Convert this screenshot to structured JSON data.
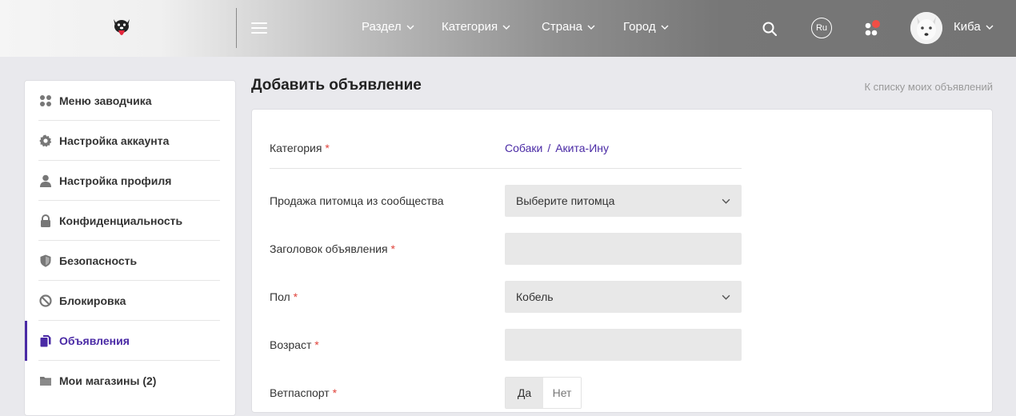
{
  "header": {
    "nav": [
      {
        "label": "Раздел"
      },
      {
        "label": "Категория"
      },
      {
        "label": "Страна"
      },
      {
        "label": "Город"
      }
    ],
    "lang": "Ru",
    "user_name": "Киба",
    "notification_color": "#f04e45"
  },
  "sidebar": {
    "items": [
      {
        "label": "Меню заводчика",
        "icon": "grid-icon"
      },
      {
        "label": "Настройка аккаунта",
        "icon": "gear-icon"
      },
      {
        "label": "Настройка профиля",
        "icon": "user-icon"
      },
      {
        "label": "Конфиденциальность",
        "icon": "lock-icon"
      },
      {
        "label": "Безопасность",
        "icon": "shield-icon"
      },
      {
        "label": "Блокировка",
        "icon": "block-icon"
      },
      {
        "label": "Объявления",
        "icon": "documents-icon",
        "active": true
      },
      {
        "label": "Мои магазины (2)",
        "icon": "folder-icon"
      }
    ],
    "accent": "#4a2aa5"
  },
  "main": {
    "title": "Добавить объявление",
    "back_link": "К списку моих объявлений",
    "required_mark": "*",
    "form": {
      "category_label": "Категория",
      "category_path": [
        "Собаки",
        "Акита-Ину"
      ],
      "category_sep": "/",
      "community_label": "Продажа питомца из сообщества",
      "community_value": "Выберите питомца",
      "title_label": "Заголовок объявления",
      "title_value": "",
      "sex_label": "Пол",
      "sex_value": "Кобель",
      "age_label": "Возраст",
      "age_value": "",
      "vetpassport_label": "Ветпаспорт",
      "vetpassport_yes": "Да",
      "vetpassport_no": "Нет"
    }
  }
}
